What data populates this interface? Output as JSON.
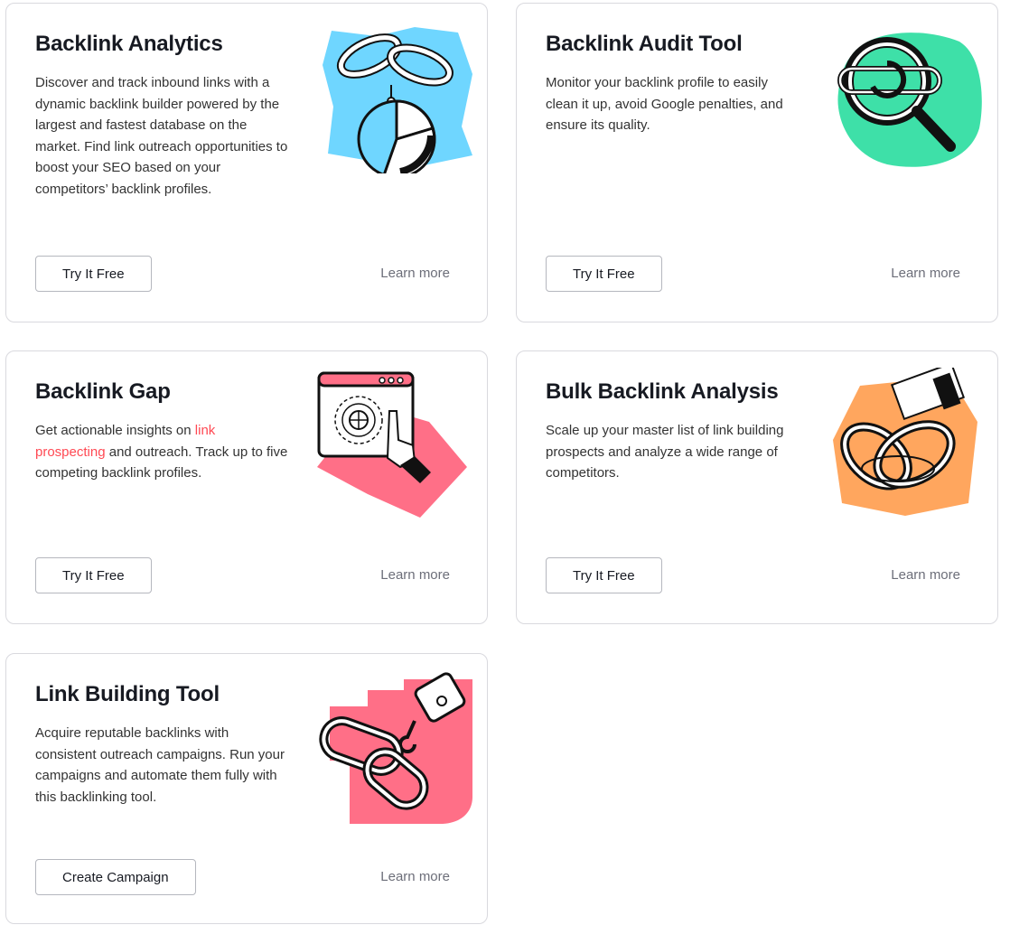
{
  "cards": [
    {
      "title": "Backlink Analytics",
      "description": "Discover and track inbound links with a dynamic backlink builder powered by the largest and fastest database on the market. Find link outreach opportunities to boost your SEO based on your competitors’ backlink profiles.",
      "button": "Try It Free",
      "learn_more": "Learn more",
      "illustration": "chain-pie-chart-illustration",
      "accent": "#6fd6ff"
    },
    {
      "title": "Backlink Audit Tool",
      "description": "Monitor your backlink profile to easily clean it up, avoid Google penalties, and ensure its quality.",
      "button": "Try It Free",
      "learn_more": "Learn more",
      "illustration": "magnifier-link-illustration",
      "accent": "#3ee0a8"
    },
    {
      "title": "Backlink Gap",
      "description_pre": "Get actionable insights on ",
      "description_link": "link prospecting",
      "description_post": " and outreach. Track up to five competing backlink profiles.",
      "button": "Try It Free",
      "learn_more": "Learn more",
      "illustration": "browser-hand-illustration",
      "accent": "#ff6f87",
      "link_color": "#ff4953"
    },
    {
      "title": "Bulk Backlink Analysis",
      "description": "Scale up your master list of link building prospects and analyze a wide range of competitors.",
      "button": "Try It Free",
      "learn_more": "Learn more",
      "illustration": "tangled-chain-illustration",
      "accent": "#ffa65e"
    },
    {
      "title": "Link Building Tool",
      "description": "Acquire reputable backlinks with consistent outreach campaigns. Run your campaigns and automate them fully with this backlinking tool.",
      "button": "Create Campaign",
      "learn_more": "Learn more",
      "illustration": "crane-hook-chain-illustration",
      "accent": "#ff6f87"
    }
  ]
}
